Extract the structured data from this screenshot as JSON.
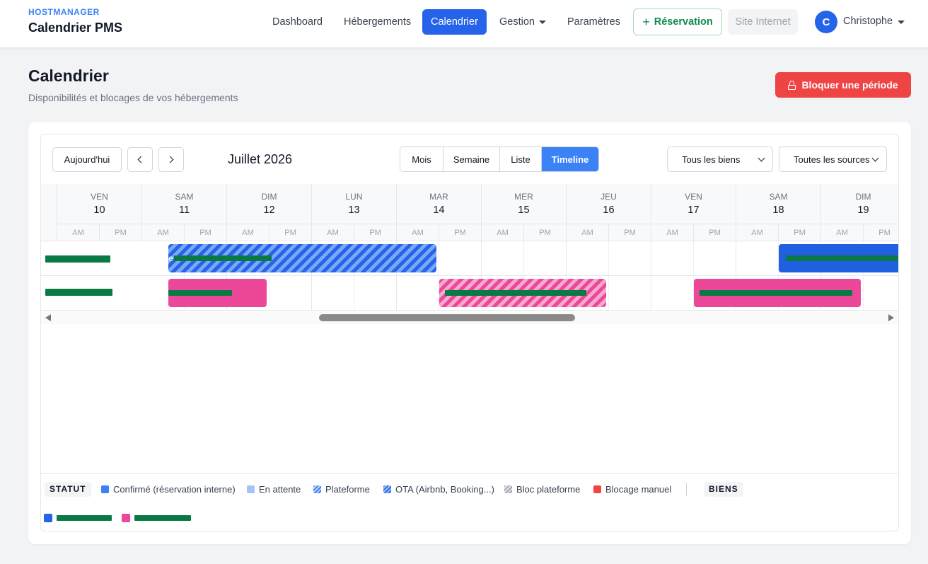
{
  "header": {
    "brand_small": "HOSTMANAGER",
    "brand_title": "Calendrier PMS",
    "nav": [
      {
        "label": "Dashboard",
        "active": false
      },
      {
        "label": "Hébergements",
        "active": false
      },
      {
        "label": "Calendrier",
        "active": true
      },
      {
        "label": "Gestion",
        "active": false,
        "has_dropdown": true
      },
      {
        "label": "Paramètres",
        "active": false
      }
    ],
    "reservation_button": "Réservation",
    "site_button": "Site Internet",
    "user": {
      "initial": "C",
      "name": "Christophe"
    }
  },
  "page": {
    "title": "Calendrier",
    "subtitle": "Disponibilités et blocages de vos hébergements",
    "block_button": "Bloquer une période"
  },
  "toolbar": {
    "today": "Aujourd'hui",
    "month_title": "Juillet 2026",
    "views": [
      {
        "label": "Mois",
        "active": false
      },
      {
        "label": "Semaine",
        "active": false
      },
      {
        "label": "Liste",
        "active": false
      },
      {
        "label": "Timeline",
        "active": true
      }
    ],
    "filter_properties": "Tous les biens",
    "filter_sources": "Toutes les sources"
  },
  "timeline": {
    "days": [
      {
        "name": "VEN",
        "num": "10"
      },
      {
        "name": "SAM",
        "num": "11"
      },
      {
        "name": "DIM",
        "num": "12"
      },
      {
        "name": "LUN",
        "num": "13"
      },
      {
        "name": "MAR",
        "num": "14"
      },
      {
        "name": "MER",
        "num": "15"
      },
      {
        "name": "JEU",
        "num": "16"
      },
      {
        "name": "VEN",
        "num": "17"
      },
      {
        "name": "SAM",
        "num": "18"
      },
      {
        "name": "DIM",
        "num": "19"
      }
    ],
    "half_labels": [
      "AM",
      "PM"
    ],
    "events": [
      {
        "row": 0,
        "style": "blue-hatch",
        "prefix": "e"
      },
      {
        "row": 0,
        "style": "blue",
        "prefix": ""
      },
      {
        "row": 1,
        "style": "pink",
        "prefix": ""
      },
      {
        "row": 1,
        "style": "pink-hatch",
        "prefix": ""
      },
      {
        "row": 1,
        "style": "pink",
        "prefix": ""
      }
    ]
  },
  "legend": {
    "statut_tag": "STATUT",
    "items": [
      {
        "label": "Confirmé (réservation interne)",
        "swatch": "confirm"
      },
      {
        "label": "En attente",
        "swatch": "wait"
      },
      {
        "label": "Plateforme",
        "swatch": "plat"
      },
      {
        "label": "OTA (Airbnb, Booking...)",
        "swatch": "ota"
      },
      {
        "label": "Bloc plateforme",
        "swatch": "bloc"
      },
      {
        "label": "Blocage manuel",
        "swatch": "manual"
      }
    ],
    "biens_tag": "BIENS",
    "bien_colors": [
      "#2563eb",
      "#ec4899"
    ]
  },
  "colors": {
    "primary": "#2563eb",
    "danger": "#ef4444",
    "success": "#0f8a4f",
    "pink": "#ec4899"
  }
}
